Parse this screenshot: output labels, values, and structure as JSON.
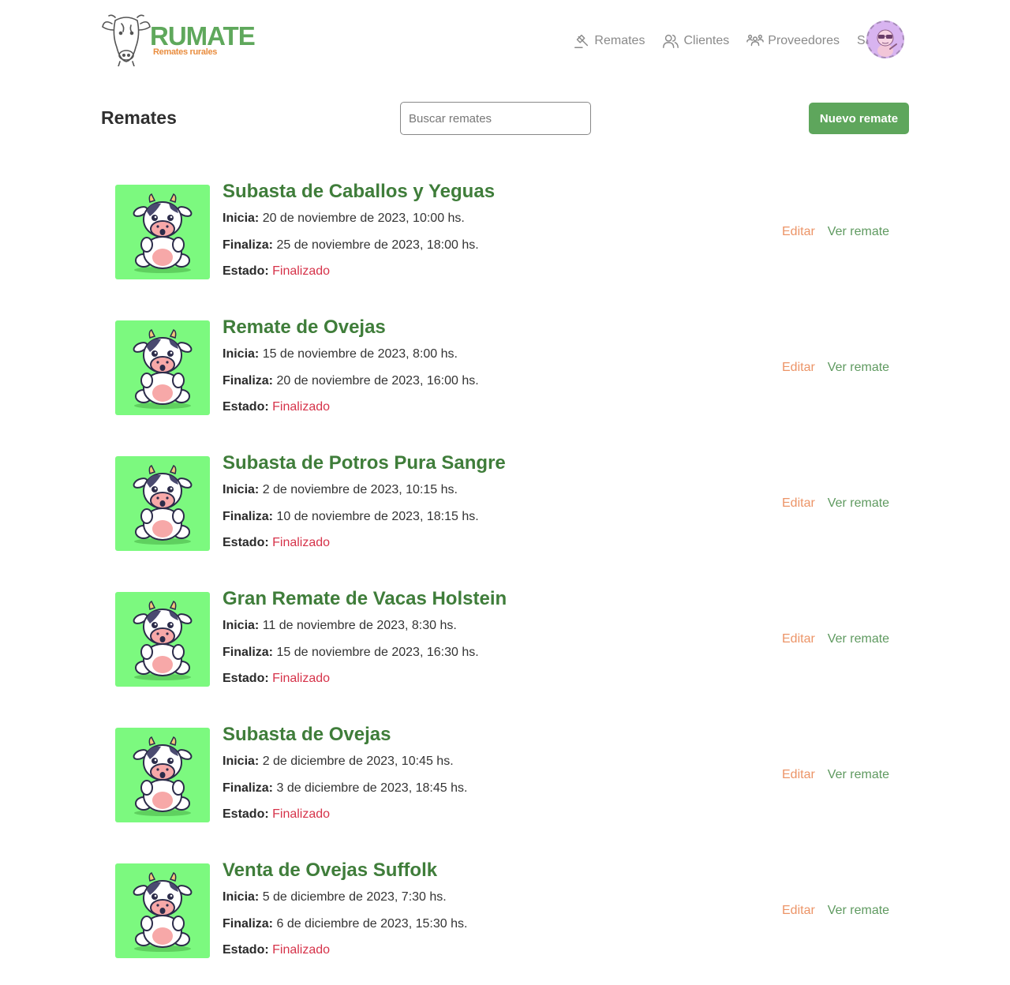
{
  "header": {
    "brand": "RUMATE",
    "tagline": "Remates rurales",
    "nav": [
      {
        "label": "Remates",
        "icon": "gavel-icon"
      },
      {
        "label": "Clientes",
        "icon": "users-icon"
      },
      {
        "label": "Proveedores",
        "icon": "group-icon"
      },
      {
        "label": "Salir",
        "icon": "logout-icon"
      }
    ]
  },
  "toolbar": {
    "title": "Remates",
    "search_placeholder": "Buscar remates",
    "new_button": "Nuevo remate"
  },
  "labels": {
    "start": "Inicia:",
    "end": "Finaliza:",
    "status": "Estado:",
    "edit": "Editar",
    "view": "Ver remate"
  },
  "auctions": [
    {
      "title": "Subasta de Caballos y Yeguas",
      "start": "20 de noviembre de 2023, 10:00 hs.",
      "end": "25 de noviembre de 2023, 18:00 hs.",
      "status": "Finalizado"
    },
    {
      "title": "Remate de Ovejas",
      "start": "15 de noviembre de 2023, 8:00 hs.",
      "end": "20 de noviembre de 2023, 16:00 hs.",
      "status": "Finalizado"
    },
    {
      "title": "Subasta de Potros Pura Sangre",
      "start": "2 de noviembre de 2023, 10:15 hs.",
      "end": "10 de noviembre de 2023, 18:15 hs.",
      "status": "Finalizado"
    },
    {
      "title": "Gran Remate de Vacas Holstein",
      "start": "11 de noviembre de 2023, 8:30 hs.",
      "end": "15 de noviembre de 2023, 16:30 hs.",
      "status": "Finalizado"
    },
    {
      "title": "Subasta de Ovejas",
      "start": "2 de diciembre de 2023, 10:45 hs.",
      "end": "3 de diciembre de 2023, 18:45 hs.",
      "status": "Finalizado"
    },
    {
      "title": "Venta de Ovejas Suffolk",
      "start": "5 de diciembre de 2023, 7:30 hs.",
      "end": "6 de diciembre de 2023, 15:30 hs.",
      "status": "Finalizado"
    }
  ],
  "colors": {
    "brand_green": "#5fa85c",
    "tagline_orange": "#e98d3f",
    "thumb_bg": "#7cf97f",
    "status_red": "#d6334a",
    "edit_orange": "#ec9467",
    "view_green": "#5f9a60"
  }
}
